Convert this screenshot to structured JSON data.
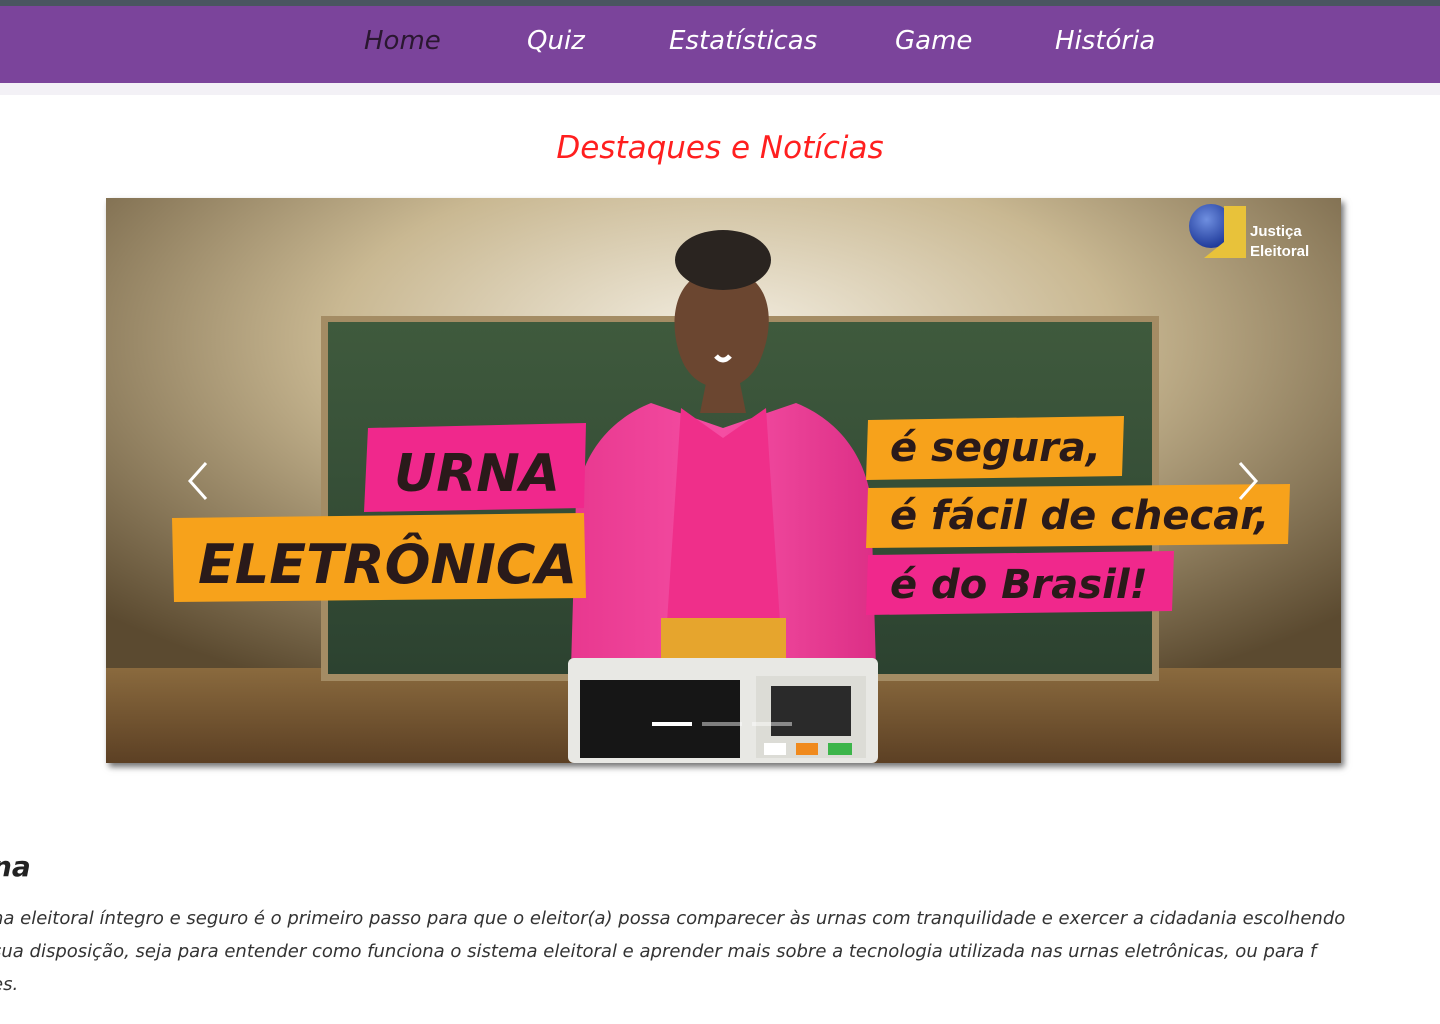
{
  "nav": {
    "items": [
      {
        "label": "Home",
        "active": true
      },
      {
        "label": "Quiz",
        "active": false
      },
      {
        "label": "Estatísticas",
        "active": false
      },
      {
        "label": "Game",
        "active": false
      },
      {
        "label": "História",
        "active": false
      }
    ]
  },
  "highlights": {
    "title": "Destaques e Notícias"
  },
  "carousel": {
    "slide_text": {
      "urna": "URNA",
      "eletronica": "ELETRÔNICA",
      "line1": "é segura,",
      "line2": "é fácil de checar,",
      "line3": "é do Brasil!"
    },
    "logo": {
      "line1": "Justiça",
      "line2": "Eleitoral"
    },
    "active_slide": 1,
    "slide_count": 3
  },
  "article": {
    "heading": "na",
    "lines": [
      "na eleitoral íntegro e seguro é o primeiro passo para que o eleitor(a) possa comparecer às urnas com tranquilidade e exercer a cidadania escolhendo",
      " sua disposição, seja para entender como funciona o sistema eleitoral e aprender mais sobre a tecnologia utilizada nas urnas eletrônicas, ou para f",
      "es."
    ]
  },
  "colors": {
    "nav_bg": "#7b449b",
    "title_red": "#ff1f1f",
    "pink_band": "#f0288c",
    "orange_band": "#f7a21b"
  }
}
